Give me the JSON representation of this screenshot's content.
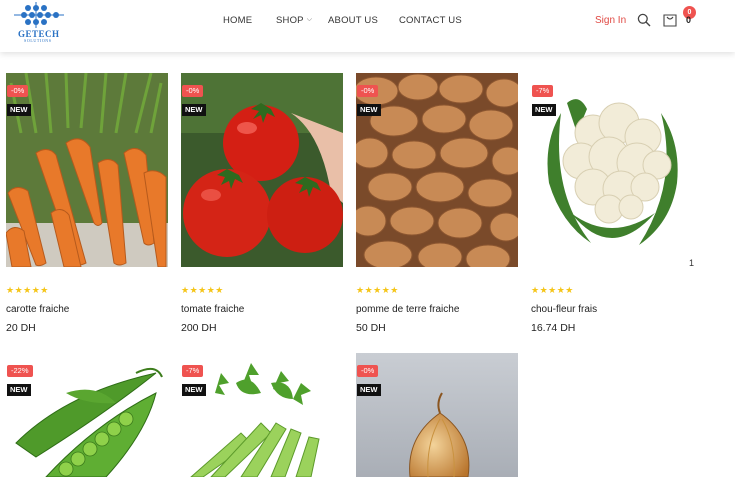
{
  "header": {
    "logo_text": "GETECH",
    "logo_sub": "SOLUTIONS",
    "nav": [
      {
        "label": "HOME"
      },
      {
        "label": "SHOP"
      },
      {
        "label": "ABOUT US"
      },
      {
        "label": "CONTACT US"
      }
    ],
    "signin": "Sign In",
    "cart_badge": "0",
    "cart_count": "0"
  },
  "colors": {
    "accent": "#ef5350",
    "signin": "#e04a44",
    "star": "#f5c518"
  },
  "products": [
    {
      "name": "carotte fraiche",
      "price": "20 DH",
      "discount": "-0%",
      "tag": "NEW",
      "rating": "★★★★★",
      "image": "carrots"
    },
    {
      "name": "tomate fraiche",
      "price": "200 DH",
      "discount": "-0%",
      "tag": "NEW",
      "rating": "★★★★★",
      "image": "tomatoes"
    },
    {
      "name": "pomme de terre fraiche",
      "price": "50 DH",
      "discount": "-0%",
      "tag": "NEW",
      "rating": "★★★★★",
      "image": "potatoes"
    },
    {
      "name": "chou-fleur frais",
      "price": "16.74 DH",
      "discount": "-7%",
      "tag": "NEW",
      "rating": "★★★★★",
      "image": "cauliflower"
    },
    {
      "name": "",
      "price": "",
      "discount": "-22%",
      "tag": "NEW",
      "rating": "",
      "image": "peas"
    },
    {
      "name": "",
      "price": "",
      "discount": "-7%",
      "tag": "NEW",
      "rating": "",
      "image": "celery"
    },
    {
      "name": "",
      "price": "",
      "discount": "-0%",
      "tag": "NEW",
      "rating": "",
      "image": "onion"
    }
  ],
  "stray_mark": "1"
}
